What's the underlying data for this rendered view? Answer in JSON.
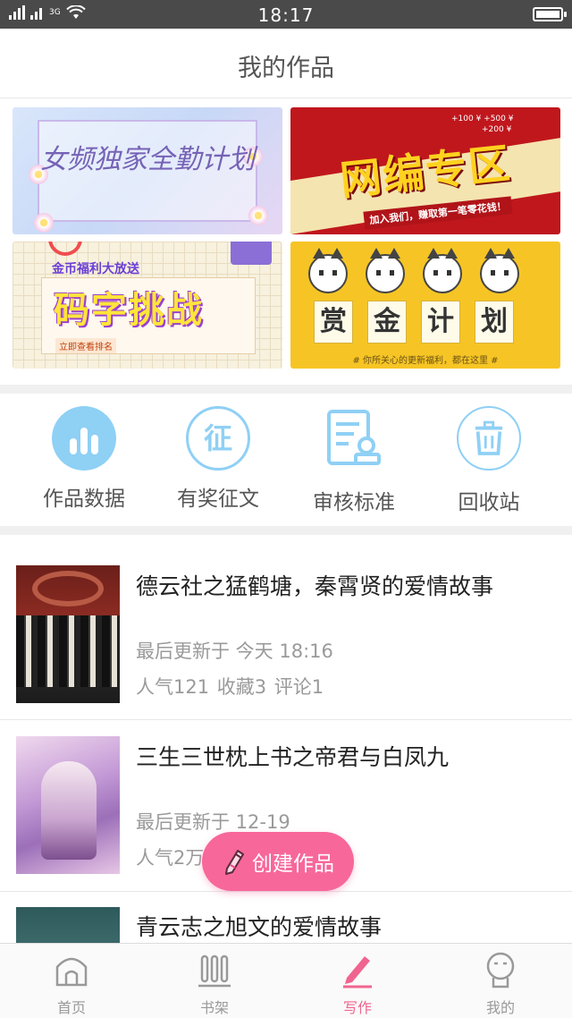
{
  "status_bar": {
    "network": "3G",
    "time": "18:17"
  },
  "header": {
    "title": "我的作品"
  },
  "banners": [
    {
      "text": "女频独家全勤计划"
    },
    {
      "text": "网编专区",
      "money_a": "+100 ¥  +500 ¥",
      "money_b": "+200 ¥",
      "subtitle": "加入我们，赚取第一笔零花钱！"
    },
    {
      "head": "金币福利大放送",
      "text": "码字挑战",
      "note": "立即查看排名"
    },
    {
      "chars": [
        "赏",
        "金",
        "计",
        "划"
      ],
      "caption": "# 你所关心的更新福利，都在这里 #"
    }
  ],
  "quick_entries": [
    {
      "label": "作品数据",
      "icon": "bar-chart-icon"
    },
    {
      "label": "有奖征文",
      "icon": "zheng-icon",
      "glyph": "征"
    },
    {
      "label": "审核标准",
      "icon": "review-document-icon"
    },
    {
      "label": "回收站",
      "icon": "trash-icon"
    }
  ],
  "works": [
    {
      "title": "德云社之猛鹤塘，秦霄贤的爱情故事",
      "updated": "最后更新于 今天 18:16",
      "stats": "人气121 收藏3 评论1"
    },
    {
      "title": "三生三世枕上书之帝君与白凤九",
      "updated": "最后更新于 12-19",
      "stats": "人气2万 收藏 评论 7"
    },
    {
      "title": "青云志之旭文的爱情故事"
    }
  ],
  "fab": {
    "label": "创建作品",
    "icon": "pencil-icon"
  },
  "tabbar": [
    {
      "label": "首页",
      "icon": "home-icon"
    },
    {
      "label": "书架",
      "icon": "bookshelf-icon"
    },
    {
      "label": "写作",
      "icon": "write-pencil-icon"
    },
    {
      "label": "我的",
      "icon": "profile-icon"
    }
  ],
  "colors": {
    "accent": "#f7679a",
    "icon_blue": "#8fd0f5",
    "tab_active": "#f0658f"
  }
}
